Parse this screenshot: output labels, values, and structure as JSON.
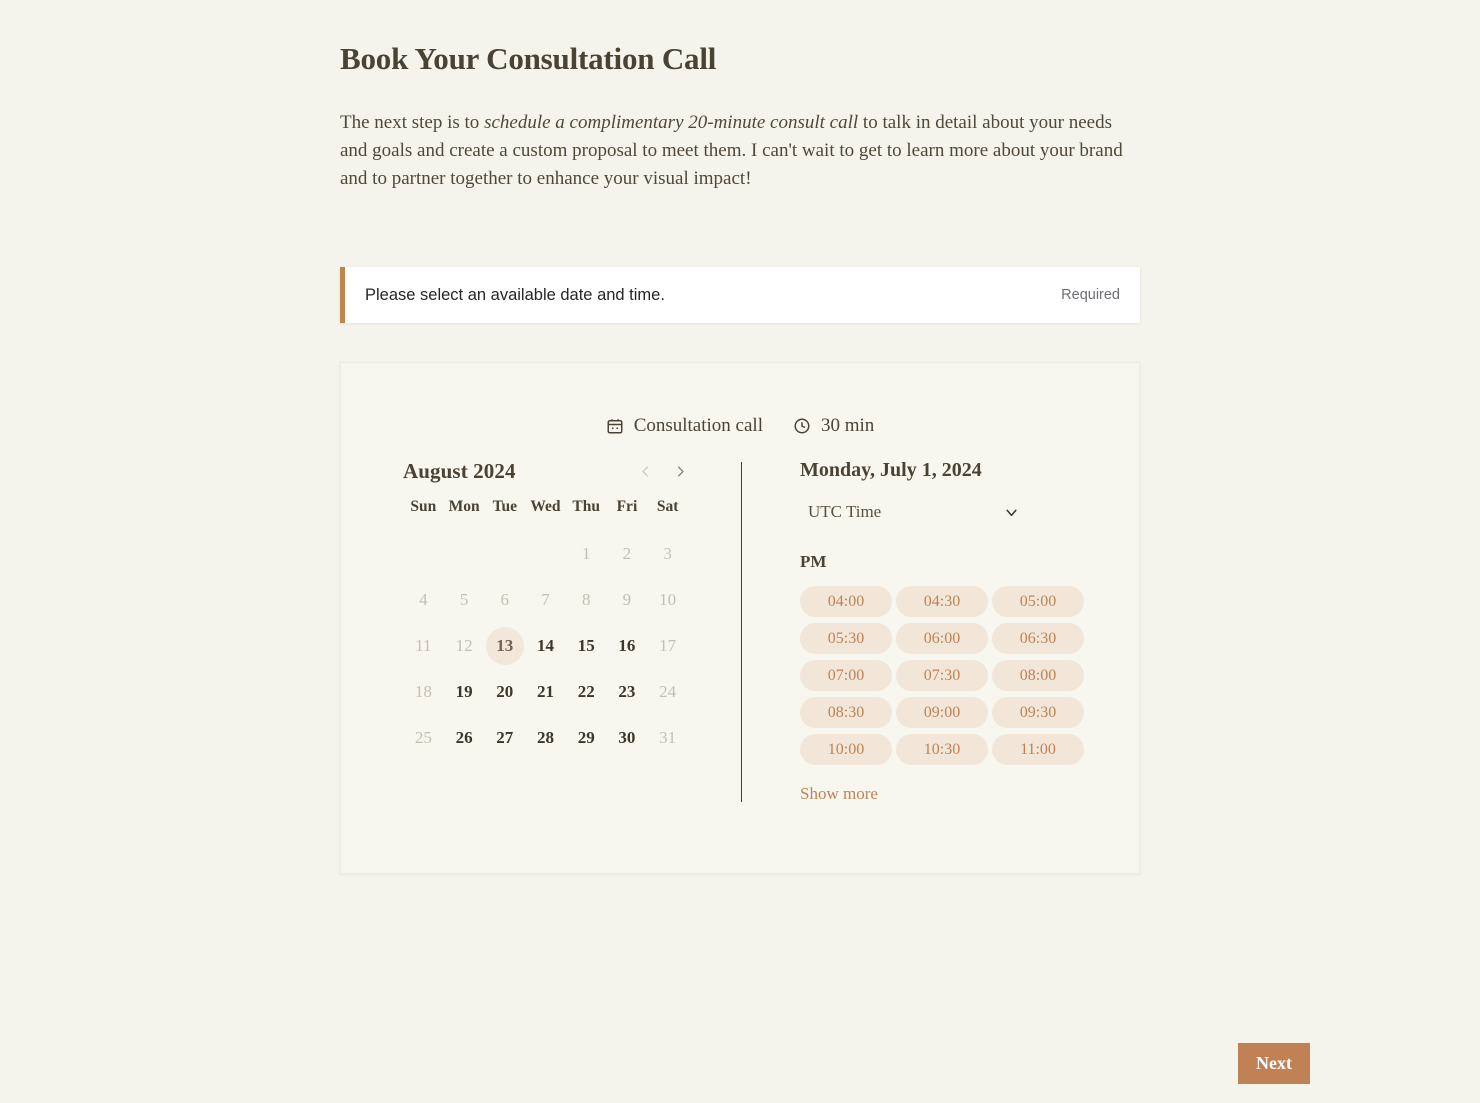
{
  "page": {
    "title": "Book Your Consultation Call",
    "intro_prefix": "The next step is to ",
    "intro_emphasis": "schedule a complimentary 20-minute consult call",
    "intro_suffix": " to talk in detail about your needs and goals and create a custom proposal to meet them. I can't wait to get to learn more about your brand and to partner together to enhance your visual impact!"
  },
  "alert": {
    "message": "Please select an available date and time.",
    "required_label": "Required",
    "accent_color": "#c0854f"
  },
  "booking": {
    "event_name": "Consultation call",
    "duration": "30 min",
    "calendar_icon": "calendar-icon",
    "clock_icon": "clock-icon",
    "calendar": {
      "month_label": "August 2024",
      "prev_icon": "chevron-left-icon",
      "next_icon": "chevron-right-icon",
      "weekdays": [
        "Sun",
        "Mon",
        "Tue",
        "Wed",
        "Thu",
        "Fri",
        "Sat"
      ],
      "leading_blanks": 4,
      "days": [
        {
          "n": "1",
          "state": "disabled"
        },
        {
          "n": "2",
          "state": "disabled"
        },
        {
          "n": "3",
          "state": "disabled"
        },
        {
          "n": "4",
          "state": "disabled"
        },
        {
          "n": "5",
          "state": "disabled"
        },
        {
          "n": "6",
          "state": "disabled"
        },
        {
          "n": "7",
          "state": "disabled"
        },
        {
          "n": "8",
          "state": "disabled"
        },
        {
          "n": "9",
          "state": "disabled"
        },
        {
          "n": "10",
          "state": "disabled"
        },
        {
          "n": "11",
          "state": "disabled"
        },
        {
          "n": "12",
          "state": "disabled"
        },
        {
          "n": "13",
          "state": "selected"
        },
        {
          "n": "14",
          "state": "enabled"
        },
        {
          "n": "15",
          "state": "enabled"
        },
        {
          "n": "16",
          "state": "enabled"
        },
        {
          "n": "17",
          "state": "disabled"
        },
        {
          "n": "18",
          "state": "disabled"
        },
        {
          "n": "19",
          "state": "enabled"
        },
        {
          "n": "20",
          "state": "enabled"
        },
        {
          "n": "21",
          "state": "enabled"
        },
        {
          "n": "22",
          "state": "enabled"
        },
        {
          "n": "23",
          "state": "enabled"
        },
        {
          "n": "24",
          "state": "disabled"
        },
        {
          "n": "25",
          "state": "disabled"
        },
        {
          "n": "26",
          "state": "enabled"
        },
        {
          "n": "27",
          "state": "enabled"
        },
        {
          "n": "28",
          "state": "enabled"
        },
        {
          "n": "29",
          "state": "enabled"
        },
        {
          "n": "30",
          "state": "enabled"
        },
        {
          "n": "31",
          "state": "disabled"
        }
      ],
      "selected_day": "13"
    },
    "times": {
      "selected_date_label": "Monday, July 1, 2024",
      "timezone_value": "UTC Time",
      "timezone_chevron_icon": "chevron-down-icon",
      "period_label": "PM",
      "slots": [
        "04:00",
        "04:30",
        "05:00",
        "05:30",
        "06:00",
        "06:30",
        "07:00",
        "07:30",
        "08:00",
        "08:30",
        "09:00",
        "09:30",
        "10:00",
        "10:30",
        "11:00"
      ],
      "show_more_label": "Show more",
      "slot_bg_color": "#f2e6d9",
      "slot_text_color": "#c08254"
    }
  },
  "footer": {
    "next_label": "Next",
    "next_color": "#c08254"
  }
}
